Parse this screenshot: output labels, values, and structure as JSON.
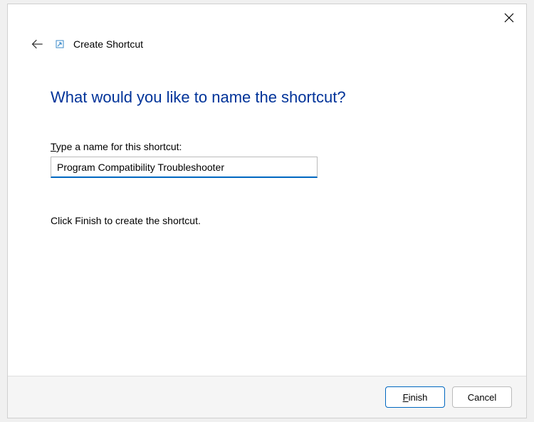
{
  "header": {
    "title": "Create Shortcut"
  },
  "main": {
    "heading": "What would you like to name the shortcut?",
    "field_label_prefix": "T",
    "field_label_rest": "ype a name for this shortcut:",
    "input_value": "Program Compatibility Troubleshooter",
    "instruction": "Click Finish to create the shortcut."
  },
  "footer": {
    "finish_prefix": "F",
    "finish_rest": "inish",
    "cancel": "Cancel"
  }
}
